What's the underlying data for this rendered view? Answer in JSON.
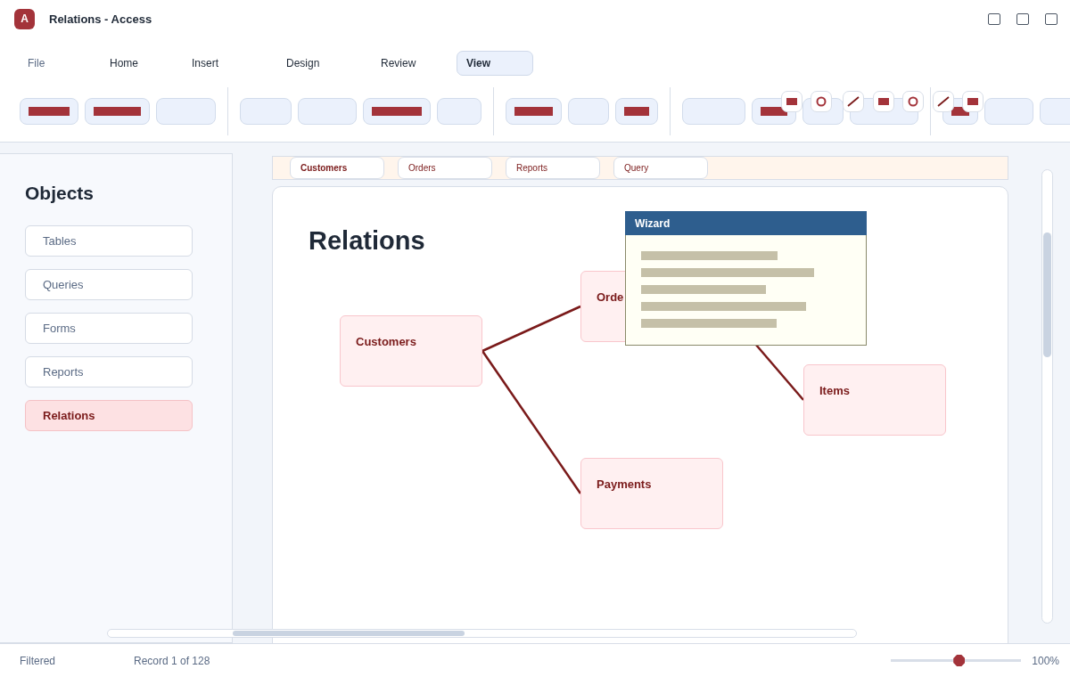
{
  "window": {
    "title": "Relations - Access",
    "app_icon": "A"
  },
  "menu_tabs": [
    {
      "label": "File",
      "kind": "file",
      "selected": false
    },
    {
      "label": "Home",
      "kind": "tab",
      "selected": false
    },
    {
      "label": "Insert",
      "kind": "tab",
      "selected": false
    },
    {
      "label": "Design",
      "kind": "tab",
      "selected": false
    },
    {
      "label": "Review",
      "kind": "tab",
      "selected": false
    },
    {
      "label": "View",
      "kind": "tab",
      "selected": true
    }
  ],
  "ribbon": {
    "groups": [
      {
        "buttons": [
          {
            "kind": "bar"
          },
          {
            "kind": "bar"
          },
          {
            "kind": "blank"
          }
        ]
      },
      {
        "buttons": [
          {
            "kind": "blank"
          },
          {
            "kind": "blank"
          },
          {
            "kind": "bar"
          },
          {
            "kind": "blank"
          }
        ]
      },
      {
        "buttons": [
          {
            "kind": "bar"
          },
          {
            "kind": "blank"
          },
          {
            "kind": "bar"
          }
        ]
      },
      {
        "buttons": [
          {
            "kind": "blank"
          },
          {
            "kind": "bar"
          },
          {
            "kind": "blank"
          },
          {
            "kind": "blank"
          }
        ]
      },
      {
        "buttons": [
          {
            "kind": "bar"
          },
          {
            "kind": "blank"
          },
          {
            "kind": "blank"
          }
        ]
      }
    ],
    "floating_tools": [
      {
        "kind": "square"
      },
      {
        "kind": "circle"
      },
      {
        "kind": "line"
      },
      {
        "kind": "square"
      },
      {
        "kind": "circle"
      },
      {
        "kind": "line"
      },
      {
        "kind": "square"
      }
    ]
  },
  "sidebar": {
    "title": "Objects",
    "items": [
      {
        "label": "Tables",
        "selected": false
      },
      {
        "label": "Queries",
        "selected": false
      },
      {
        "label": "Forms",
        "selected": false
      },
      {
        "label": "Reports",
        "selected": false
      },
      {
        "label": "Relations",
        "selected": true
      }
    ]
  },
  "doc_tabs": [
    {
      "label": "Customers",
      "selected": true
    },
    {
      "label": "Orders",
      "selected": false
    },
    {
      "label": "Reports",
      "selected": false
    },
    {
      "label": "Query",
      "selected": false
    }
  ],
  "canvas": {
    "title": "Relations",
    "tables": [
      {
        "name": "Customers"
      },
      {
        "name": "Orde"
      },
      {
        "name": "Items"
      },
      {
        "name": "Payments"
      }
    ]
  },
  "wizard": {
    "title": "Wizard"
  },
  "status_bar": {
    "filter": "Filtered",
    "record": "Record 1 of 128",
    "zoom": {
      "level": 0.52,
      "reading": "100%"
    }
  }
}
